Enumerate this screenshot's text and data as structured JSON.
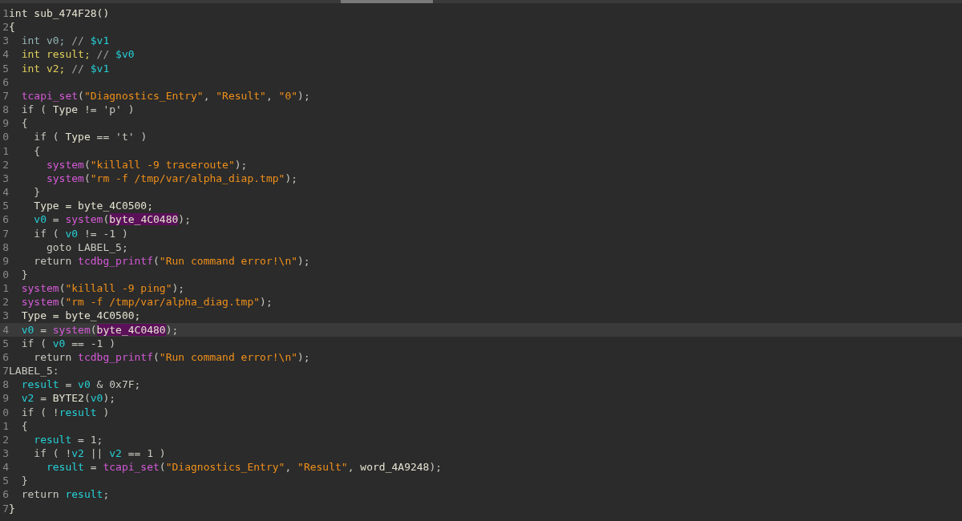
{
  "editor": {
    "lines": [
      {
        "number": "1",
        "current": false,
        "tokens": [
          {
            "kind": "head",
            "text": "int sub_474F28()"
          }
        ]
      },
      {
        "number": "2",
        "current": false,
        "tokens": [
          {
            "kind": "head",
            "text": "{"
          }
        ]
      },
      {
        "number": "3",
        "current": false,
        "tokens": [
          {
            "kind": "teal",
            "text": "  int v0;"
          },
          {
            "kind": "cmt",
            "text": " // "
          },
          {
            "kind": "var",
            "text": "$v1"
          }
        ]
      },
      {
        "number": "4",
        "current": false,
        "tokens": [
          {
            "kind": "decl",
            "text": "  int result;"
          },
          {
            "kind": "cmt",
            "text": " // "
          },
          {
            "kind": "var",
            "text": "$v0"
          }
        ]
      },
      {
        "number": "5",
        "current": false,
        "tokens": [
          {
            "kind": "decl",
            "text": "  int v2;"
          },
          {
            "kind": "cmt",
            "text": " // "
          },
          {
            "kind": "var",
            "text": "$v1"
          }
        ]
      },
      {
        "number": "6",
        "current": false
      },
      {
        "number": "7",
        "current": false,
        "tokens": [
          {
            "kind": "func",
            "text": "  tcapi_set"
          },
          {
            "kind": "plain",
            "text": "("
          },
          {
            "kind": "str",
            "text": "\"Diagnostics_Entry\""
          },
          {
            "kind": "plain",
            "text": ", "
          },
          {
            "kind": "str",
            "text": "\"Result\""
          },
          {
            "kind": "plain",
            "text": ", "
          },
          {
            "kind": "str",
            "text": "\"0\""
          },
          {
            "kind": "plain",
            "text": ");"
          }
        ]
      },
      {
        "number": "8",
        "current": false,
        "tokens": [
          {
            "kind": "plain",
            "text": "  if ( "
          },
          {
            "kind": "head",
            "text": "Type"
          },
          {
            "kind": "plain",
            "text": " != 'p' )"
          }
        ]
      },
      {
        "number": "9",
        "current": false,
        "tokens": [
          {
            "kind": "plain",
            "text": "  {"
          }
        ]
      },
      {
        "number": "0",
        "current": false,
        "tokens": [
          {
            "kind": "plain",
            "text": "    if ( "
          },
          {
            "kind": "head",
            "text": "Type"
          },
          {
            "kind": "plain",
            "text": " == 't' )"
          }
        ]
      },
      {
        "number": "1",
        "current": false,
        "tokens": [
          {
            "kind": "plain",
            "text": "    {"
          }
        ]
      },
      {
        "number": "2",
        "current": false,
        "tokens": [
          {
            "kind": "func",
            "text": "      system"
          },
          {
            "kind": "plain",
            "text": "("
          },
          {
            "kind": "str",
            "text": "\"killall -9 traceroute\""
          },
          {
            "kind": "plain",
            "text": ");"
          }
        ]
      },
      {
        "number": "3",
        "current": false,
        "tokens": [
          {
            "kind": "func",
            "text": "      system"
          },
          {
            "kind": "plain",
            "text": "("
          },
          {
            "kind": "str",
            "text": "\"rm -f /tmp/var/alpha_diap.tmp\""
          },
          {
            "kind": "plain",
            "text": ");"
          }
        ]
      },
      {
        "number": "4",
        "current": false,
        "tokens": [
          {
            "kind": "plain",
            "text": "    }"
          }
        ]
      },
      {
        "number": "5",
        "current": false,
        "tokens": [
          {
            "kind": "head",
            "text": "    Type = byte_4C0500;"
          }
        ]
      },
      {
        "number": "6",
        "current": false,
        "tokens": [
          {
            "kind": "var",
            "text": "    v0"
          },
          {
            "kind": "plain",
            "text": " = "
          },
          {
            "kind": "func",
            "text": "system"
          },
          {
            "kind": "plain",
            "text": "("
          },
          {
            "kind": "hl",
            "text": "byte_4C0480"
          },
          {
            "kind": "plain",
            "text": ");"
          }
        ]
      },
      {
        "number": "7",
        "current": false,
        "tokens": [
          {
            "kind": "plain",
            "text": "    if ( "
          },
          {
            "kind": "var",
            "text": "v0"
          },
          {
            "kind": "plain",
            "text": " != -1 )"
          }
        ]
      },
      {
        "number": "8",
        "current": false,
        "tokens": [
          {
            "kind": "plain",
            "text": "      goto LABEL_5;"
          }
        ]
      },
      {
        "number": "9",
        "current": false,
        "tokens": [
          {
            "kind": "plain",
            "text": "    return "
          },
          {
            "kind": "func",
            "text": "tcdbg_printf"
          },
          {
            "kind": "plain",
            "text": "("
          },
          {
            "kind": "str",
            "text": "\"Run command error!\\n\""
          },
          {
            "kind": "plain",
            "text": ");"
          }
        ]
      },
      {
        "number": "0",
        "current": false,
        "tokens": [
          {
            "kind": "plain",
            "text": "  }"
          }
        ]
      },
      {
        "number": "1",
        "current": false,
        "tokens": [
          {
            "kind": "func",
            "text": "  system"
          },
          {
            "kind": "plain",
            "text": "("
          },
          {
            "kind": "str",
            "text": "\"killall -9 ping\""
          },
          {
            "kind": "plain",
            "text": ");"
          }
        ]
      },
      {
        "number": "2",
        "current": false,
        "tokens": [
          {
            "kind": "func",
            "text": "  system"
          },
          {
            "kind": "plain",
            "text": "("
          },
          {
            "kind": "str",
            "text": "\"rm -f /tmp/var/alpha_diag.tmp\""
          },
          {
            "kind": "plain",
            "text": ");"
          }
        ]
      },
      {
        "number": "3",
        "current": false,
        "tokens": [
          {
            "kind": "head",
            "text": "  Type = byte_4C0500;"
          }
        ]
      },
      {
        "number": "4",
        "current": true,
        "tokens": [
          {
            "kind": "var",
            "text": "  v0"
          },
          {
            "kind": "plain",
            "text": " = "
          },
          {
            "kind": "func",
            "text": "system"
          },
          {
            "kind": "plain",
            "text": "("
          },
          {
            "kind": "hl",
            "text": "byte_4C0480"
          },
          {
            "kind": "plain",
            "text": ");"
          }
        ]
      },
      {
        "number": "5",
        "current": false,
        "tokens": [
          {
            "kind": "plain",
            "text": "  if ( "
          },
          {
            "kind": "var",
            "text": "v0"
          },
          {
            "kind": "plain",
            "text": " == -1 )"
          }
        ]
      },
      {
        "number": "6",
        "current": false,
        "tokens": [
          {
            "kind": "plain",
            "text": "    return "
          },
          {
            "kind": "func",
            "text": "tcdbg_printf"
          },
          {
            "kind": "plain",
            "text": "("
          },
          {
            "kind": "str",
            "text": "\"Run command error!\\n\""
          },
          {
            "kind": "plain",
            "text": ");"
          }
        ]
      },
      {
        "number": "7",
        "current": false,
        "tokens": [
          {
            "kind": "plain",
            "text": "LABEL_5:"
          }
        ]
      },
      {
        "number": "8",
        "current": false,
        "tokens": [
          {
            "kind": "var",
            "text": "  result"
          },
          {
            "kind": "plain",
            "text": " = "
          },
          {
            "kind": "var",
            "text": "v0"
          },
          {
            "kind": "plain",
            "text": " & 0x7F;"
          }
        ]
      },
      {
        "number": "9",
        "current": false,
        "tokens": [
          {
            "kind": "var",
            "text": "  v2"
          },
          {
            "kind": "plain",
            "text": " = "
          },
          {
            "kind": "head",
            "text": "BYTE2"
          },
          {
            "kind": "plain",
            "text": "("
          },
          {
            "kind": "var",
            "text": "v0"
          },
          {
            "kind": "plain",
            "text": ");"
          }
        ]
      },
      {
        "number": "0",
        "current": false,
        "tokens": [
          {
            "kind": "plain",
            "text": "  if ( !"
          },
          {
            "kind": "var",
            "text": "result"
          },
          {
            "kind": "plain",
            "text": " )"
          }
        ]
      },
      {
        "number": "1",
        "current": false,
        "tokens": [
          {
            "kind": "plain",
            "text": "  {"
          }
        ]
      },
      {
        "number": "2",
        "current": false,
        "tokens": [
          {
            "kind": "var",
            "text": "    result"
          },
          {
            "kind": "plain",
            "text": " = 1;"
          }
        ]
      },
      {
        "number": "3",
        "current": false,
        "tokens": [
          {
            "kind": "plain",
            "text": "    if ( !"
          },
          {
            "kind": "var",
            "text": "v2"
          },
          {
            "kind": "plain",
            "text": " || "
          },
          {
            "kind": "var",
            "text": "v2"
          },
          {
            "kind": "plain",
            "text": " == 1 )"
          }
        ]
      },
      {
        "number": "4",
        "current": false,
        "tokens": [
          {
            "kind": "var",
            "text": "      result"
          },
          {
            "kind": "plain",
            "text": " = "
          },
          {
            "kind": "func",
            "text": "tcapi_set"
          },
          {
            "kind": "plain",
            "text": "("
          },
          {
            "kind": "str",
            "text": "\"Diagnostics_Entry\""
          },
          {
            "kind": "plain",
            "text": ", "
          },
          {
            "kind": "str",
            "text": "\"Result\""
          },
          {
            "kind": "plain",
            "text": ", "
          },
          {
            "kind": "head",
            "text": "word_4A9248"
          },
          {
            "kind": "plain",
            "text": ");"
          }
        ]
      },
      {
        "number": "5",
        "current": false,
        "tokens": [
          {
            "kind": "plain",
            "text": "  }"
          }
        ]
      },
      {
        "number": "6",
        "current": false,
        "tokens": [
          {
            "kind": "plain",
            "text": "  return "
          },
          {
            "kind": "var",
            "text": "result"
          },
          {
            "kind": "plain",
            "text": ";"
          }
        ]
      },
      {
        "number": "7",
        "current": false,
        "tokens": [
          {
            "kind": "head",
            "text": "}"
          }
        ]
      }
    ]
  }
}
